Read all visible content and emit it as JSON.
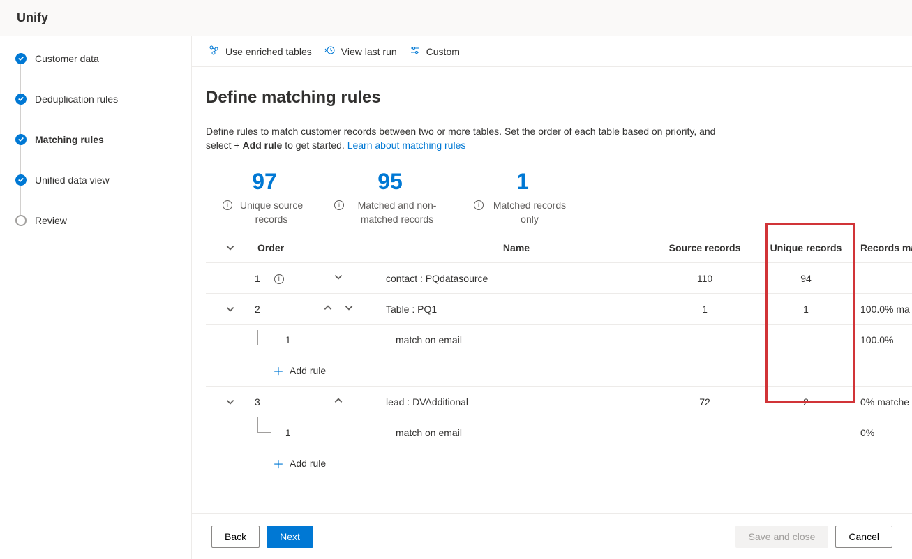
{
  "app_title": "Unify",
  "steps": {
    "customer_data": "Customer data",
    "deduplication": "Deduplication rules",
    "matching": "Matching rules",
    "unified": "Unified data view",
    "review": "Review"
  },
  "commands": {
    "enriched": "Use enriched tables",
    "view_last": "View last run",
    "custom": "Custom"
  },
  "page": {
    "heading": "Define matching rules",
    "desc_part1": "Define rules to match customer records between two or more tables. Set the order of each table based on priority, and select + ",
    "desc_bold": "Add rule",
    "desc_part2": " to get started. ",
    "learn_link": "Learn about matching rules"
  },
  "stats": {
    "unique_source": {
      "value": "97",
      "label": "Unique source records"
    },
    "matched_nonmatched": {
      "value": "95",
      "label": "Matched and non-matched records"
    },
    "matched_only": {
      "value": "1",
      "label": "Matched records only"
    }
  },
  "columns": {
    "order": "Order",
    "name": "Name",
    "source": "Source records",
    "unique": "Unique records",
    "match": "Records ma"
  },
  "rows": {
    "r1": {
      "order": "1",
      "name": "contact : PQdatasource",
      "source": "110",
      "unique": "94",
      "match": ""
    },
    "r2": {
      "order": "2",
      "name": "Table : PQ1",
      "source": "1",
      "unique": "1",
      "match": "100.0% ma"
    },
    "r2_sub": {
      "order": "1",
      "name": "match on email",
      "match": "100.0%"
    },
    "r3": {
      "order": "3",
      "name": "lead : DVAdditional",
      "source": "72",
      "unique": "2",
      "match": "0% matche"
    },
    "r3_sub": {
      "order": "1",
      "name": "match on email",
      "match": "0%"
    }
  },
  "add_rule": "Add rule",
  "footer": {
    "back": "Back",
    "next": "Next",
    "save_close": "Save and close",
    "cancel": "Cancel"
  }
}
